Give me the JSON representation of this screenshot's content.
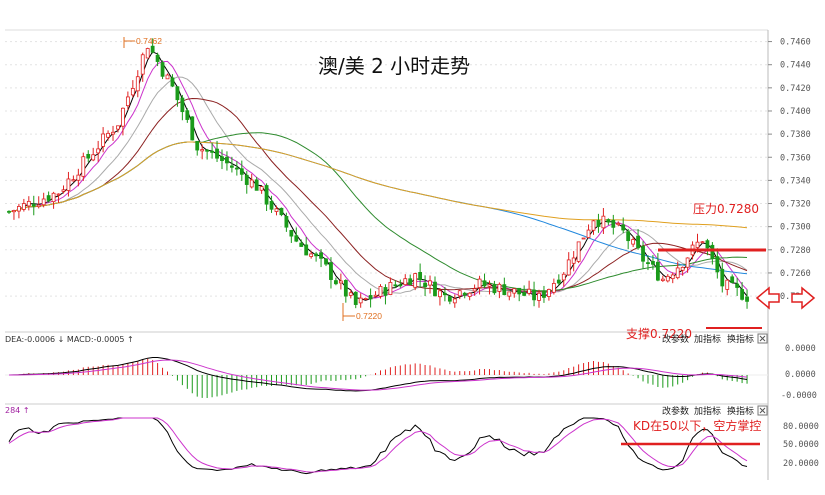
{
  "chart_data": [
    {
      "type": "candlestick",
      "title": "澳/美 2 小时走势",
      "ylim": [
        0.7215,
        0.747
      ],
      "yticks": [
        "0.7460",
        "0.7440",
        "0.7420",
        "0.7400",
        "0.7380",
        "0.7360",
        "0.7340",
        "0.7320",
        "0.7300",
        "0.7280",
        "0.7260",
        "0.7240"
      ],
      "annotations": {
        "high_marker": "0.7462",
        "low_marker": "0.7220",
        "resistance": "压力0.7280",
        "support": "支撑0.7220"
      },
      "resistance_level": 0.728,
      "support_level": 0.7225,
      "colors": {
        "up": "#e02020",
        "down": "#1a9a1a",
        "ma_black": "#000000",
        "ma_magenta": "#cc33cc",
        "ma_grey": "#aaaaaa",
        "ma_darkred": "#8b2020",
        "ma_green": "#2e8b2e",
        "ma_blue": "#2288dd",
        "ma_orange": "#e0a020"
      }
    },
    {
      "type": "macd",
      "header": "DEA:-0.0006 ↓ MACD:-0.0005 ↑",
      "yticks": [
        "0.0000",
        "0.0000",
        "-0.0000"
      ],
      "buttons": [
        "改参数",
        "加指标",
        "换指标"
      ]
    },
    {
      "type": "kdj",
      "header": "284 ↑",
      "yticks": [
        "80.0000",
        "50.0000",
        "20.0000"
      ],
      "buttons": [
        "改参数",
        "加指标",
        "换指标"
      ],
      "annotation": "KD在50以下，空方掌控",
      "level": 50
    }
  ]
}
